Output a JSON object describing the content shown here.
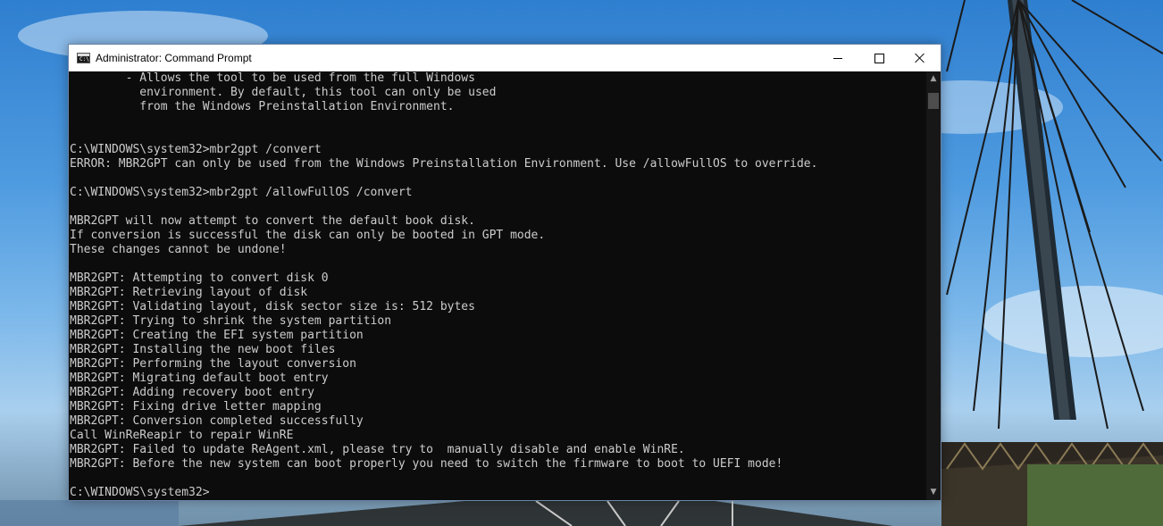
{
  "window": {
    "title": "Administrator: Command Prompt",
    "icon": "cmd-icon",
    "controls": [
      "minimize-icon",
      "maximize-icon",
      "close-icon"
    ]
  },
  "console": {
    "lines": [
      "        - Allows the tool to be used from the full Windows",
      "          environment. By default, this tool can only be used",
      "          from the Windows Preinstallation Environment.",
      "",
      "",
      "C:\\WINDOWS\\system32>mbr2gpt /convert",
      "ERROR: MBR2GPT can only be used from the Windows Preinstallation Environment. Use /allowFullOS to override.",
      "",
      "C:\\WINDOWS\\system32>mbr2gpt /allowFullOS /convert",
      "",
      "MBR2GPT will now attempt to convert the default book disk.",
      "If conversion is successful the disk can only be booted in GPT mode.",
      "These changes cannot be undone!",
      "",
      "MBR2GPT: Attempting to convert disk 0",
      "MBR2GPT: Retrieving layout of disk",
      "MBR2GPT: Validating layout, disk sector size is: 512 bytes",
      "MBR2GPT: Trying to shrink the system partition",
      "MBR2GPT: Creating the EFI system partition",
      "MBR2GPT: Installing the new boot files",
      "MBR2GPT: Performing the layout conversion",
      "MBR2GPT: Migrating default boot entry",
      "MBR2GPT: Adding recovery boot entry",
      "MBR2GPT: Fixing drive letter mapping",
      "MBR2GPT: Conversion completed successfully",
      "Call WinReReapir to repair WinRE",
      "MBR2GPT: Failed to update ReAgent.xml, please try to  manually disable and enable WinRE.",
      "MBR2GPT: Before the new system can boot properly you need to switch the firmware to boot to UEFI mode!",
      "",
      "C:\\WINDOWS\\system32>"
    ],
    "text_color": "#cccccc",
    "background": "#0c0c0c"
  },
  "scrollbar": {
    "up_icon": "▲",
    "down_icon": "▼"
  },
  "colors": {
    "sky": "#4f9be0",
    "titlebar": "#ffffff"
  }
}
